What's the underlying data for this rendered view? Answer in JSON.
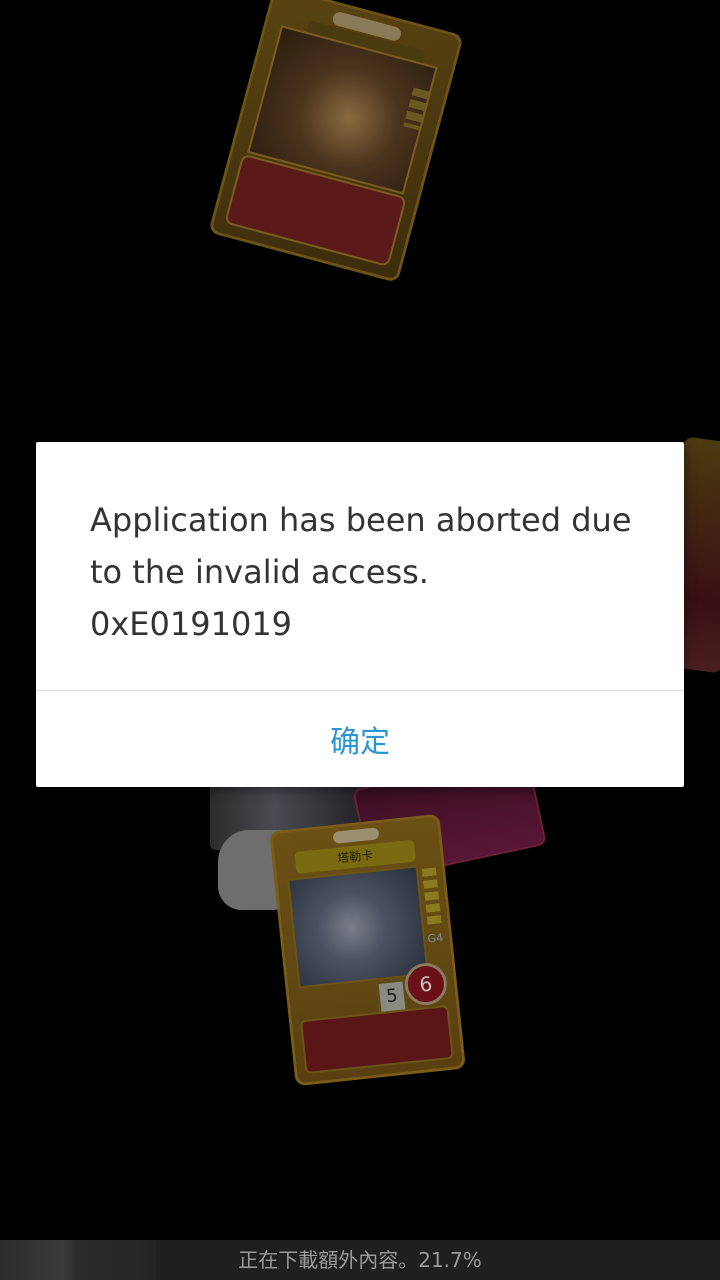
{
  "dialog": {
    "message": "Application has been aborted due\nto the invalid access.\n0xE0191019",
    "confirm_label": "确定"
  },
  "background_cards": {
    "main_card": {
      "name": "塔勒卡",
      "grade": "G4",
      "cost": "5",
      "power": "6"
    }
  },
  "download_status": {
    "text": "正在下載額外內容。21.7%",
    "progress": 0.217
  },
  "colors": {
    "dialog_background": "#ffffff",
    "confirm_text": "#2b95d4",
    "screen_background": "#000000"
  }
}
